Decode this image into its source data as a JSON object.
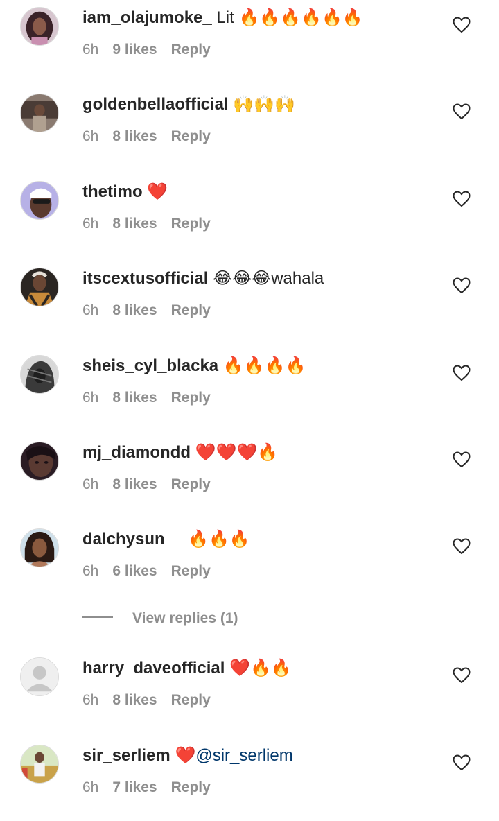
{
  "comments": [
    {
      "username": "iam_olajumoke_",
      "text": "Lit 🔥🔥🔥🔥🔥🔥",
      "time": "6h",
      "likes": "9 likes",
      "reply": "Reply",
      "avatar": "avatar-woman-curly-hair",
      "avatar_color": "#5a3a48"
    },
    {
      "username": "goldenbellaofficial",
      "text": "🙌🙌🙌",
      "time": "6h",
      "likes": "8 likes",
      "reply": "Reply",
      "avatar": "avatar-woman-car",
      "avatar_color": "#6b5a52"
    },
    {
      "username": "thetimo",
      "text": "❤️",
      "time": "6h",
      "likes": "8 likes",
      "reply": "Reply",
      "avatar": "avatar-man-sunglasses",
      "avatar_color": "#a8a2d8"
    },
    {
      "username": "itscextusofficial",
      "text": "😂😂😂wahala",
      "time": "6h",
      "likes": "8 likes",
      "reply": "Reply",
      "avatar": "avatar-man-patterned-shirt",
      "avatar_color": "#3a3330"
    },
    {
      "username": "sheis_cyl_blacka",
      "text": "🔥🔥🔥🔥",
      "time": "6h",
      "likes": "8 likes",
      "reply": "Reply",
      "avatar": "avatar-hooded-figure",
      "avatar_color": "#4a4a4a"
    },
    {
      "username": "mj_diamondd",
      "text": "❤️❤️❤️🔥",
      "time": "6h",
      "likes": "8 likes",
      "reply": "Reply",
      "avatar": "avatar-woman-closeup",
      "avatar_color": "#3b2a2e"
    },
    {
      "username": "dalchysun__",
      "text": "🔥🔥🔥",
      "time": "6h",
      "likes": "6 likes",
      "reply": "Reply",
      "avatar": "avatar-woman-smiling",
      "avatar_color": "#7a5540"
    },
    {
      "username": "harry_daveofficial",
      "text": "❤️🔥🔥",
      "time": "6h",
      "likes": "8 likes",
      "reply": "Reply",
      "avatar": "avatar-default-placeholder",
      "avatar_color": "#e0e0e0"
    },
    {
      "username": "sir_serliem",
      "text": "❤️",
      "mention": "@sir_serliem",
      "time": "6h",
      "likes": "7 likes",
      "reply": "Reply",
      "avatar": "avatar-man-outdoors",
      "avatar_color": "#c9a24a"
    }
  ],
  "view_replies": "View replies (1)",
  "icons": {
    "like": "heart-outline-icon"
  },
  "colors": {
    "text": "#262626",
    "secondary": "#8e8e8e",
    "mention": "#00376b",
    "background": "#ffffff"
  }
}
